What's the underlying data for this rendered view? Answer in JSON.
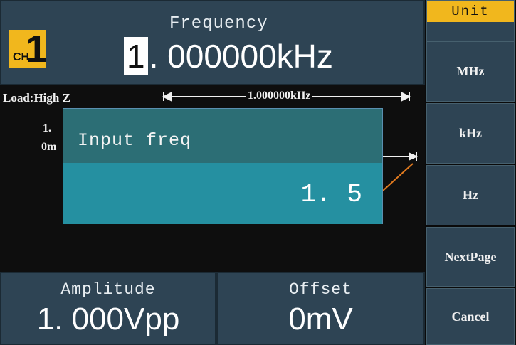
{
  "header": {
    "channel_badge": "CH",
    "channel_number": "1",
    "frequency_label": "Frequency",
    "frequency_value_first": "1",
    "frequency_value_rest": ". 000000kHz"
  },
  "waveform": {
    "load": "Load:High Z",
    "period_label": "1.000000kHz",
    "partial_amp": "1.",
    "partial_offset": "0m"
  },
  "dialog": {
    "title": "Input freq",
    "value": "1. 5"
  },
  "bottom": {
    "amplitude_label": "Amplitude",
    "amplitude_value": "1. 000Vpp",
    "offset_label": "Offset",
    "offset_value": "0mV"
  },
  "menu": {
    "title": "Unit",
    "items": [
      "MHz",
      "kHz",
      "Hz",
      "NextPage",
      "Cancel"
    ]
  },
  "colors": {
    "accent": "#f1b71d",
    "panel": "#2e4454",
    "dialog_title": "#2c6e75",
    "dialog_input": "#2590a1",
    "waveform_trace": "#e07a1f"
  }
}
